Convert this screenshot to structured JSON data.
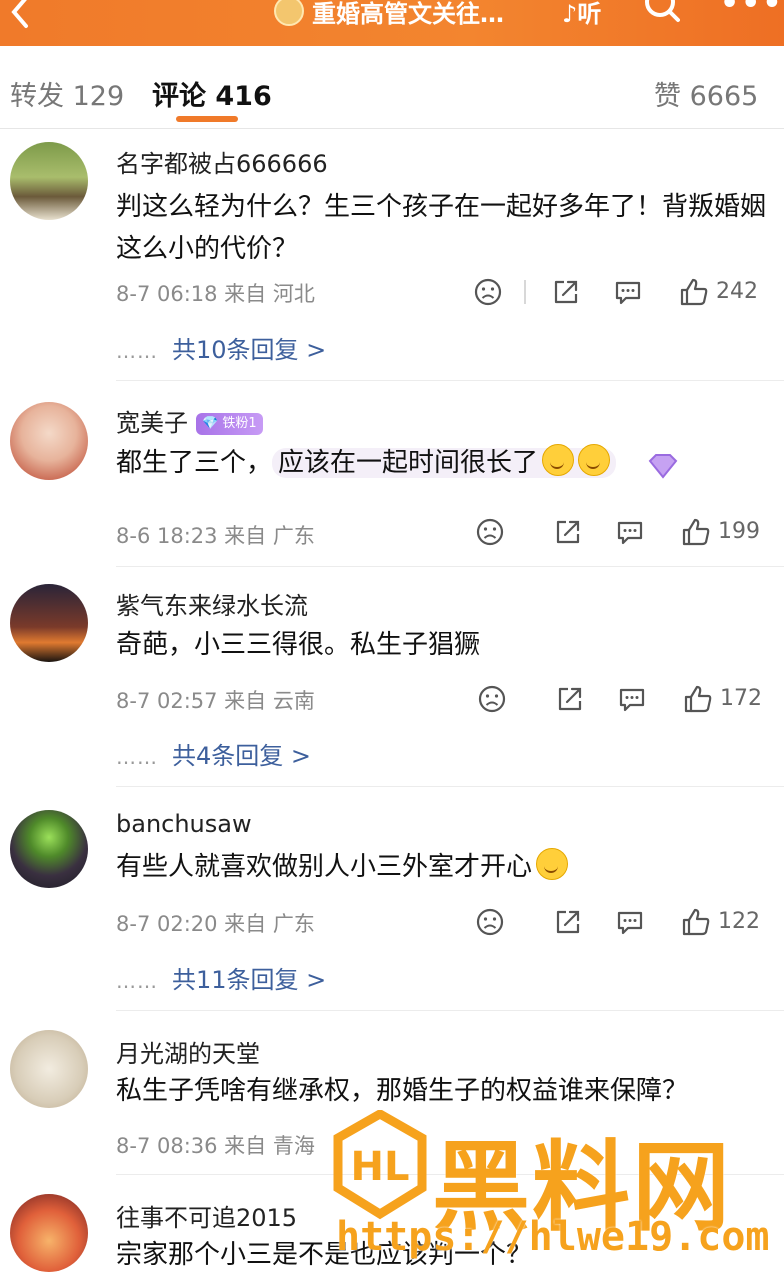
{
  "header": {
    "back_icon": "chevron-left-icon",
    "title": "重婚高管文关往…",
    "sound_label": "听",
    "search_icon": "search-icon",
    "more_icon": "more-dots-icon"
  },
  "tabs": [
    {
      "label": "转发 129"
    },
    {
      "label": "评论 416"
    },
    {
      "label": "赞 6665"
    }
  ],
  "accent_color": "#f07a2a",
  "link_color": "#3d5f9c",
  "comments": [
    {
      "username": "名字都被占666666",
      "text": "判这么轻为什么？生三个孩子在一起好多年了！背叛婚姻这么小的代价？",
      "time": "8-7 06:18 来自 河北",
      "likes": "242",
      "replies": "共10条回复 >",
      "dots": "……"
    },
    {
      "username": "宽美子",
      "badge": "💎 铁粉1",
      "text_a": "都生了三个，",
      "text_b": "应该在一起时间很长了",
      "time": "8-6 18:23 来自 广东",
      "likes": "199"
    },
    {
      "username": "紫气东来绿水长流",
      "text": "奇葩，小三三得很。私生子猖獗",
      "time": "8-7 02:57 来自 云南",
      "likes": "172",
      "replies": "共4条回复 >",
      "dots": "……"
    },
    {
      "username": "banchusaw",
      "text": "有些人就喜欢做别人小三外室才开心",
      "time": "8-7 02:20 来自 广东",
      "likes": "122",
      "replies": "共11条回复 >",
      "dots": "……"
    },
    {
      "username": "月光湖的天堂",
      "text": "私生子凭啥有继承权，那婚生子的权益谁来保障？",
      "time": "8-7 08:36 来自 青海"
    },
    {
      "username": "往事不可追2015",
      "text": "宗家那个小三是不是也应该判一个？"
    }
  ],
  "watermark": {
    "text": "黑料网",
    "url": "https://hlwe19.com"
  }
}
